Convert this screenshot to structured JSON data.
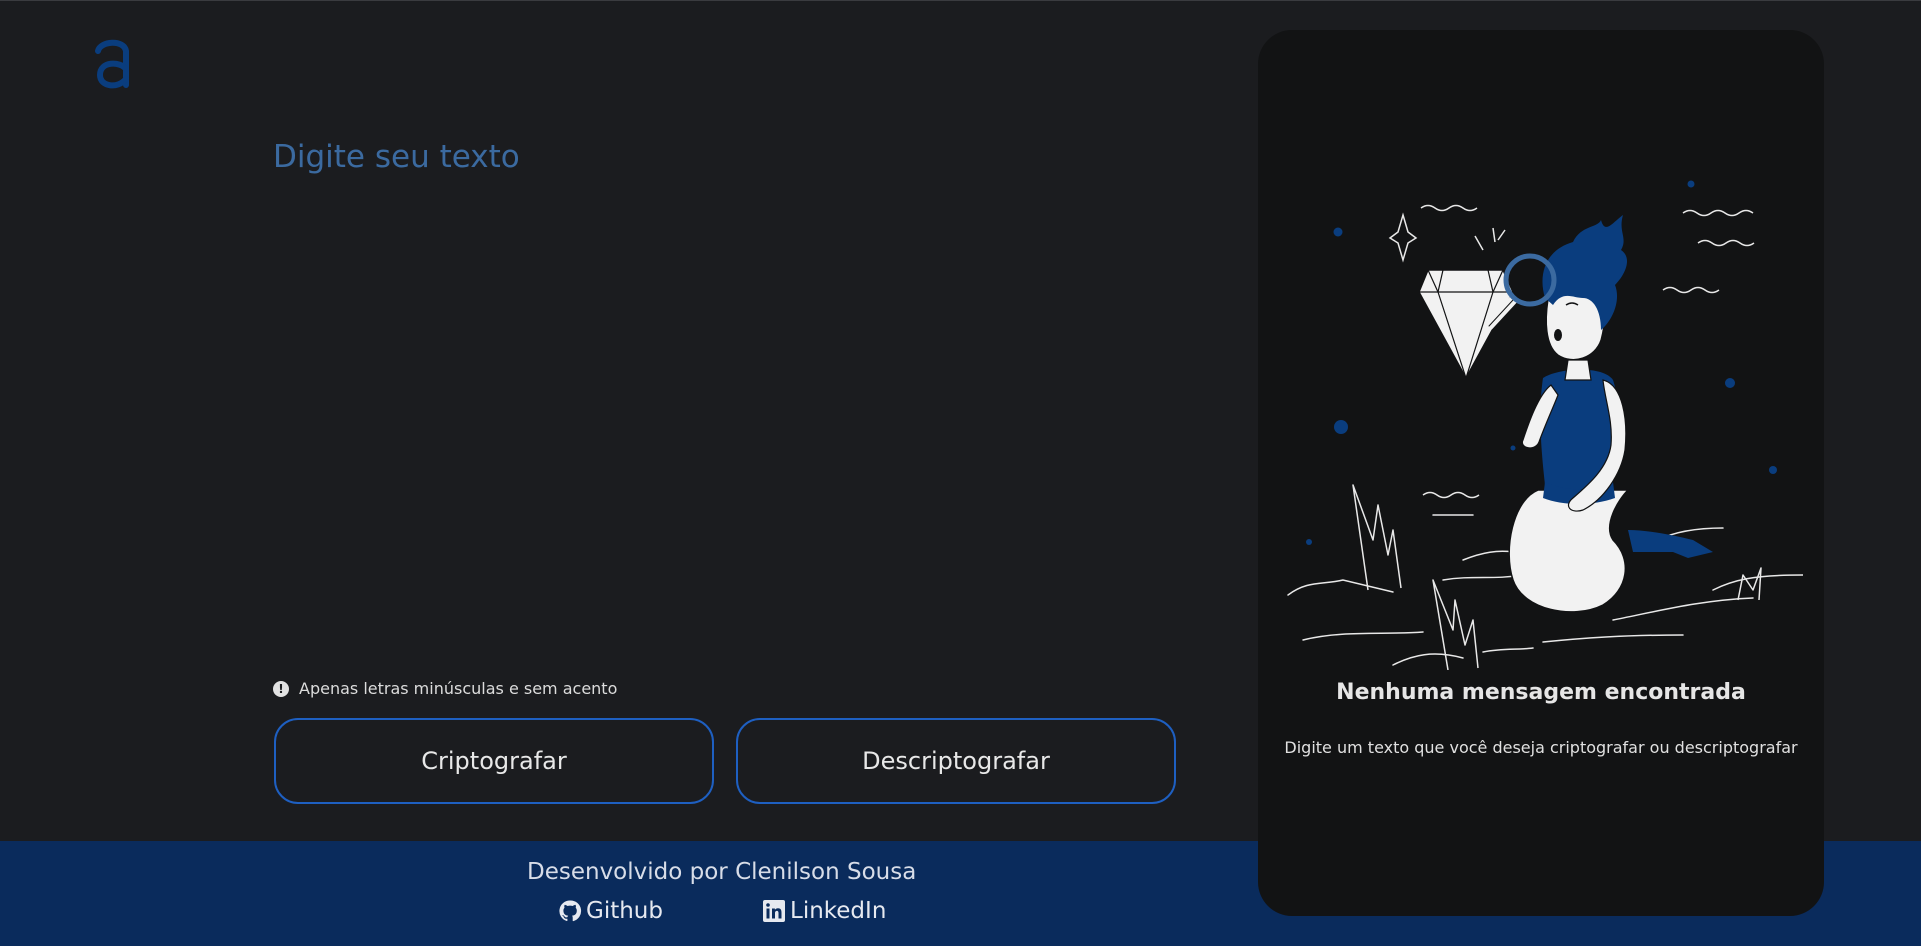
{
  "input": {
    "placeholder": "Digite seu texto",
    "value": ""
  },
  "hint": {
    "icon": "exclamation-circle-icon",
    "text": "Apenas letras minúsculas e sem acento"
  },
  "buttons": {
    "encrypt_label": "Criptografar",
    "decrypt_label": "Descriptografar"
  },
  "output": {
    "empty_title": "Nenhuma mensagem encontrada",
    "empty_description": "Digite um texto que você deseja criptografar ou descriptografar",
    "illustration": "person-with-magnifying-glass-and-diamond"
  },
  "footer": {
    "credit": "Desenvolvido por Clenilson Sousa",
    "links": [
      {
        "label": "Github",
        "icon": "github-icon"
      },
      {
        "label": "LinkedIn",
        "icon": "linkedin-icon"
      }
    ]
  },
  "colors": {
    "background": "#1b1c1f",
    "panel": "#121314",
    "accent": "#1e5fc1",
    "footer": "#0a2b5c",
    "brand": "#0a3d7e"
  }
}
